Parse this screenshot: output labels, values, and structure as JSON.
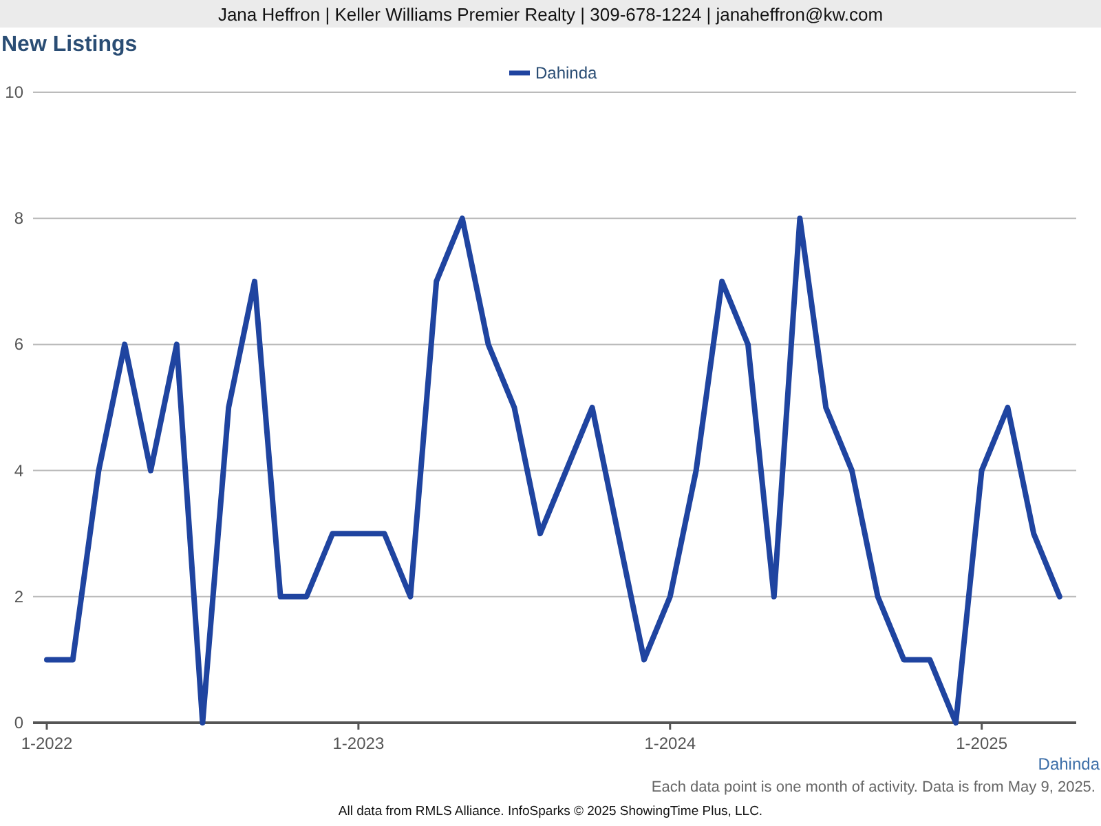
{
  "header": {
    "text": "Jana Heffron | Keller Williams Premier Realty | 309-678-1224 | janaheffron@kw.com"
  },
  "chart": {
    "chart_data": {
      "type": "line",
      "title": "New Listings",
      "categories": [
        "1-2022",
        null,
        null,
        null,
        null,
        null,
        null,
        null,
        null,
        null,
        null,
        null,
        "1-2023",
        null,
        null,
        null,
        null,
        null,
        null,
        null,
        null,
        null,
        null,
        null,
        "1-2024",
        null,
        null,
        null,
        null,
        null,
        null,
        null,
        null,
        null,
        null,
        null,
        "1-2025",
        null,
        null,
        null
      ],
      "grid": true,
      "series": [
        {
          "name": "Dahinda",
          "color": "#1f44a0",
          "values": [
            1,
            1,
            4,
            6,
            4,
            6,
            0,
            5,
            7,
            2,
            2,
            3,
            3,
            3,
            2,
            7,
            8,
            6,
            5,
            3,
            4,
            5,
            3,
            1,
            2,
            4,
            7,
            6,
            2,
            8,
            5,
            4,
            2,
            1,
            1,
            0,
            4,
            5,
            3,
            2
          ]
        }
      ],
      "ylim": [
        0,
        10
      ],
      "yticks": [
        0,
        2,
        4,
        6,
        8,
        10
      ]
    },
    "area_label": "Dahinda"
  },
  "note": "Each data point is one month of activity. Data is from May 9, 2025.",
  "footer": "All data from RMLS Alliance. InfoSparks © 2025 ShowingTime Plus, LLC."
}
